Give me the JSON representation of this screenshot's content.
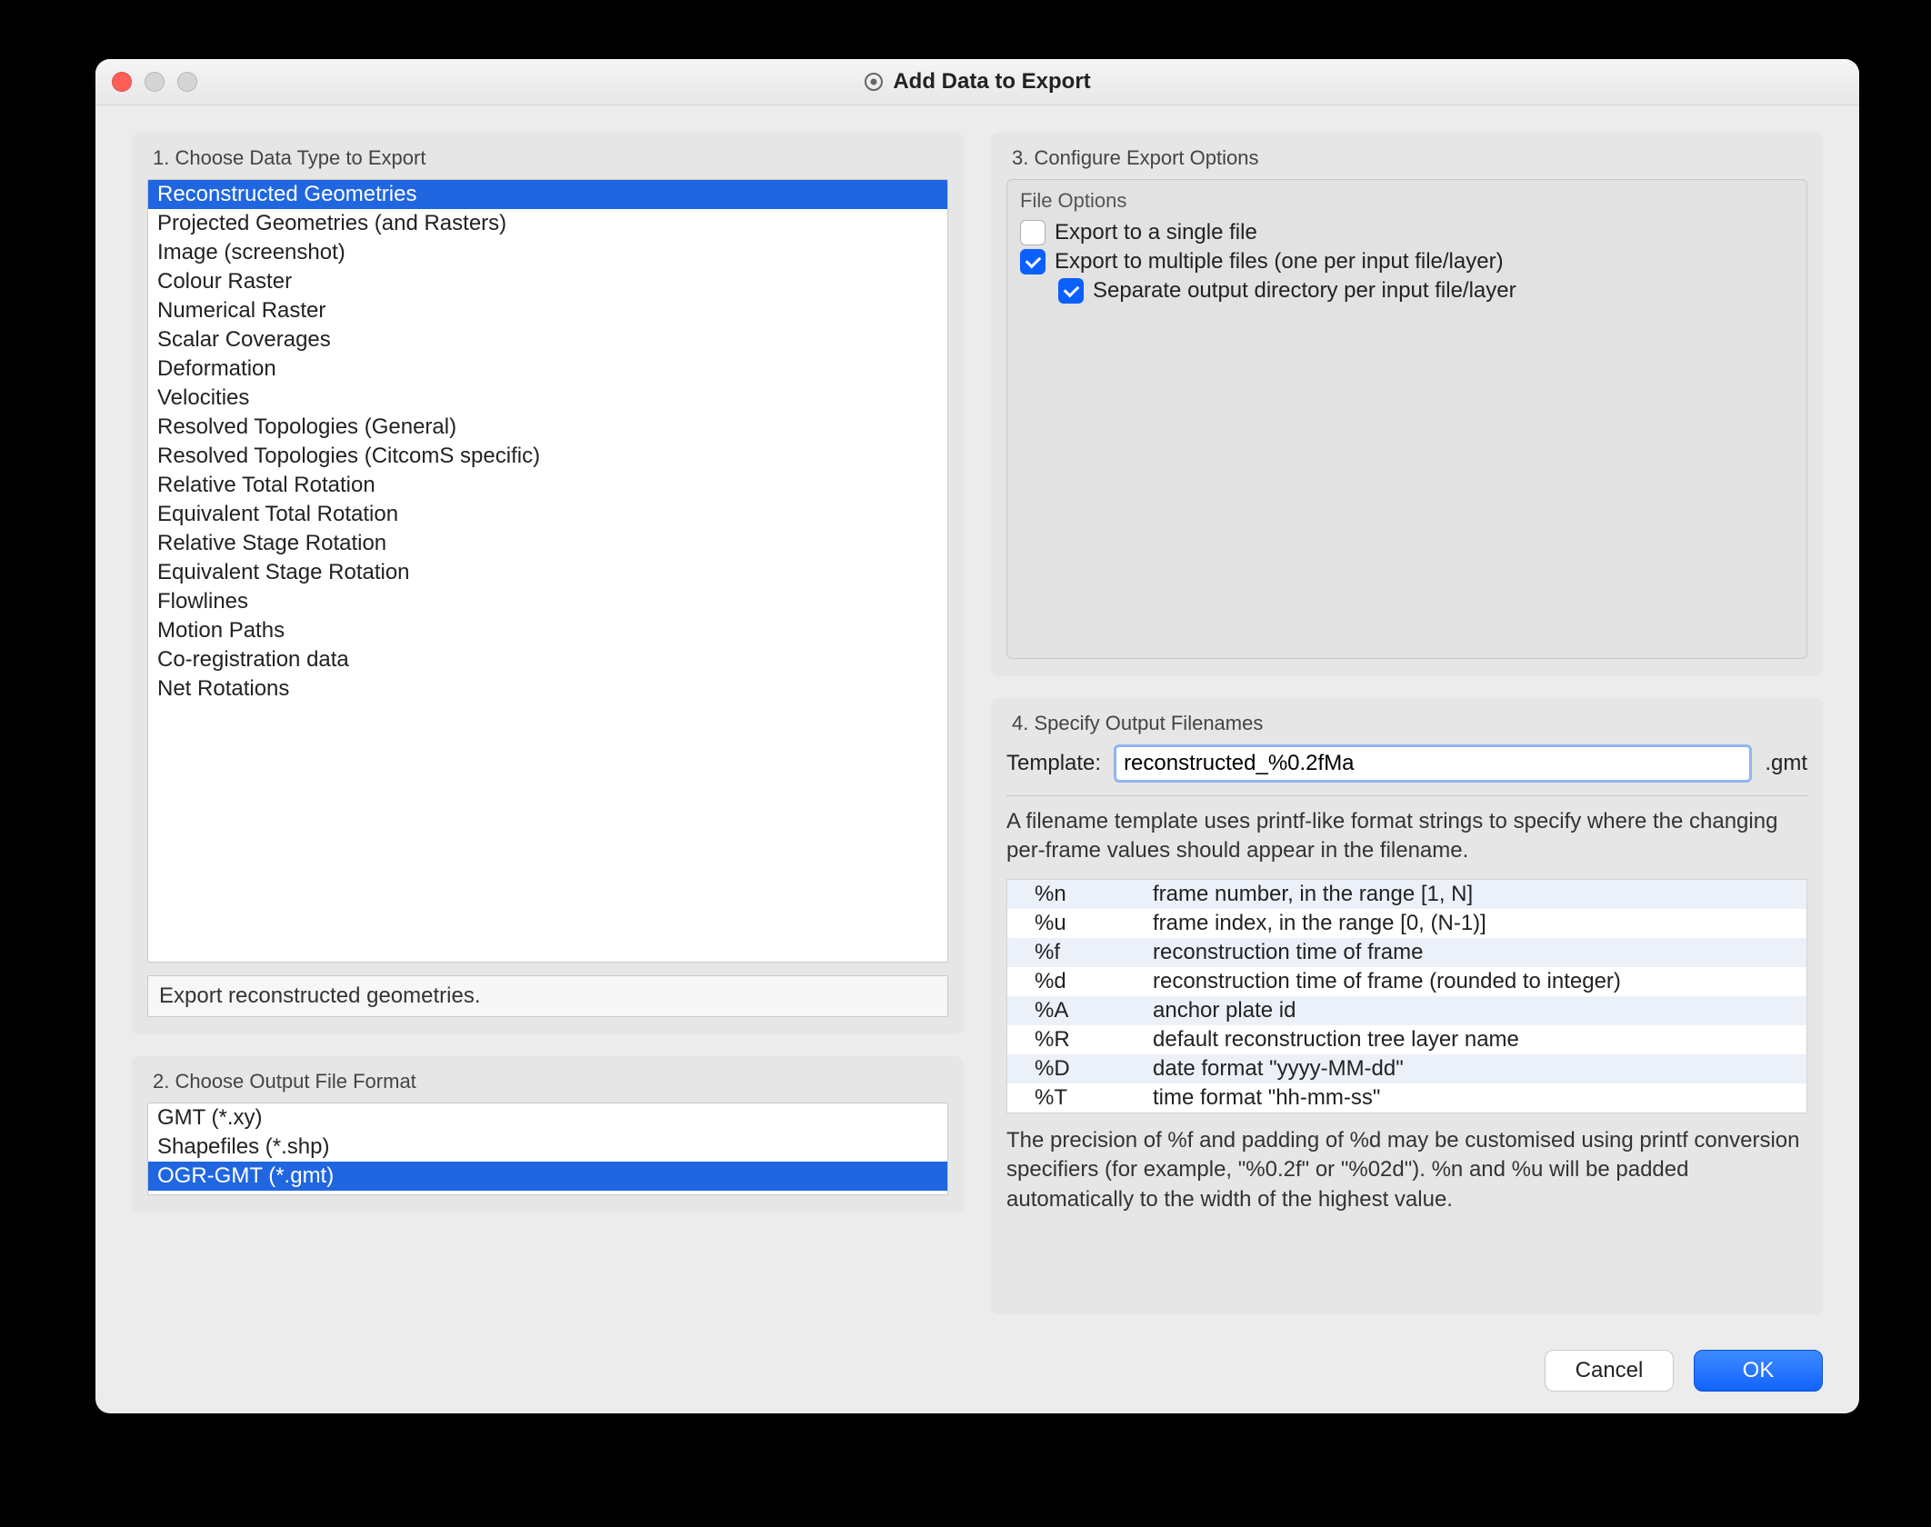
{
  "window": {
    "title": "Add Data to Export"
  },
  "section1": {
    "title": "1. Choose Data Type to Export",
    "items": [
      "Reconstructed Geometries",
      "Projected Geometries (and Rasters)",
      "Image (screenshot)",
      "Colour Raster",
      "Numerical Raster",
      "Scalar Coverages",
      "Deformation",
      "Velocities",
      "Resolved Topologies (General)",
      "Resolved Topologies (CitcomS specific)",
      "Relative Total Rotation",
      "Equivalent Total Rotation",
      "Relative Stage Rotation",
      "Equivalent Stage Rotation",
      "Flowlines",
      "Motion Paths",
      "Co-registration data",
      "Net Rotations"
    ],
    "selected_index": 0,
    "description": "Export reconstructed geometries."
  },
  "section2": {
    "title": "2. Choose Output File Format",
    "formats": [
      "GMT (*.xy)",
      "Shapefiles (*.shp)",
      "OGR-GMT (*.gmt)"
    ],
    "selected_index": 2
  },
  "section3": {
    "title": "3. Configure Export Options",
    "group_title": "File Options",
    "opt_single": "Export to a single file",
    "opt_single_checked": false,
    "opt_multi": "Export to multiple files (one per input file/layer)",
    "opt_multi_checked": true,
    "opt_sepdir": "Separate output directory per input file/layer",
    "opt_sepdir_checked": true
  },
  "section4": {
    "title": "4. Specify Output Filenames",
    "template_label": "Template:",
    "template_value": "reconstructed_%0.2fMa",
    "template_ext": ".gmt",
    "help1": "A filename template uses printf-like format strings to specify where the changing per-frame values should appear in the filename.",
    "formats": [
      {
        "code": "%n",
        "desc": "frame number, in the range [1, N]"
      },
      {
        "code": "%u",
        "desc": "frame index, in the range [0, (N-1)]"
      },
      {
        "code": "%f",
        "desc": "reconstruction time of frame"
      },
      {
        "code": "%d",
        "desc": "reconstruction time of frame (rounded to integer)"
      },
      {
        "code": "%A",
        "desc": "anchor plate id"
      },
      {
        "code": "%R",
        "desc": "default reconstruction tree layer name"
      },
      {
        "code": "%D",
        "desc": "date format \"yyyy-MM-dd\""
      },
      {
        "code": "%T",
        "desc": "time format \"hh-mm-ss\""
      }
    ],
    "help2": "The precision of %f and padding of %d may be customised using printf conversion specifiers (for example, \"%0.2f\" or \"%02d\"). %n and %u will be padded automatically to the width of the highest value."
  },
  "footer": {
    "cancel": "Cancel",
    "ok": "OK"
  }
}
